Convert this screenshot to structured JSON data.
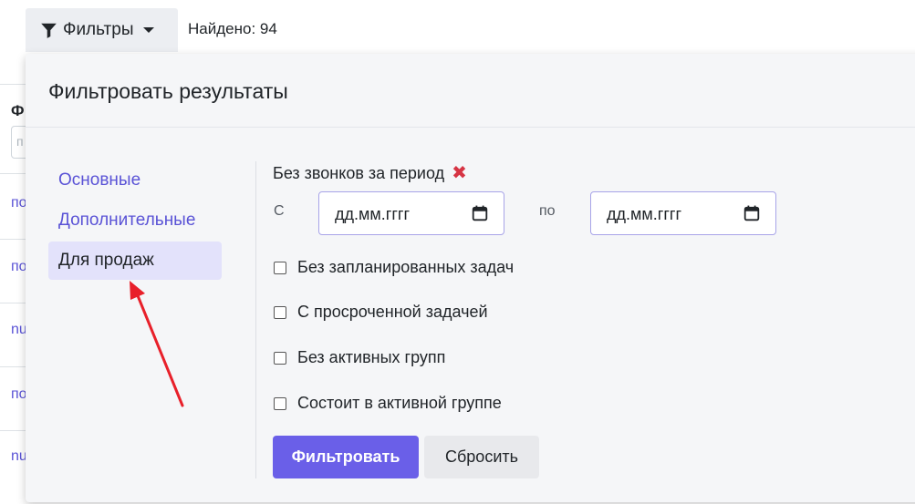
{
  "toolbar": {
    "filters_label": "Фильтры",
    "found_text": "Найдено: 94"
  },
  "background": {
    "column_header": "Ф",
    "input_placeholder": "п",
    "links": [
      "по",
      "по",
      "nu",
      "по",
      "nu"
    ]
  },
  "panel": {
    "title": "Фильтровать результаты",
    "tabs": [
      {
        "label": "Основные",
        "active": false
      },
      {
        "label": "Дополнительные",
        "active": false
      },
      {
        "label": "Для продаж",
        "active": true
      }
    ],
    "period": {
      "label": "Без звонков за период",
      "remove_icon": "✖",
      "from_label": "С",
      "to_label": "по",
      "from_placeholder": "дд.мм.гггг",
      "to_placeholder": "дд.мм.гггг"
    },
    "checkboxes": [
      {
        "label": "Без запланированных задач",
        "checked": false
      },
      {
        "label": "С просроченной задачей",
        "checked": false
      },
      {
        "label": "Без активных групп",
        "checked": false
      },
      {
        "label": "Состоит в активной группе",
        "checked": false
      }
    ],
    "buttons": {
      "filter": "Фильтровать",
      "reset": "Сбросить"
    }
  },
  "colors": {
    "accent": "#6a5fe8",
    "link": "#5a53d6",
    "active_tab_bg": "#e3e2fb",
    "remove": "#d63444",
    "annotation_arrow": "#e8202a"
  }
}
